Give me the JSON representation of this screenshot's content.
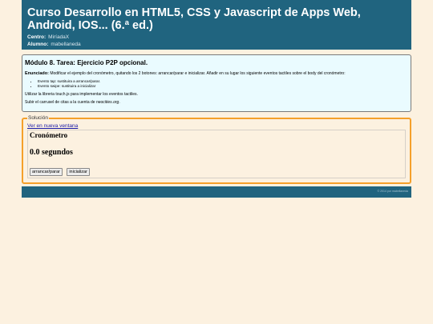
{
  "header": {
    "title": "Curso Desarrollo en HTML5, CSS y Javascript de Apps Web, Android, IOS... (6.ª ed.)",
    "center_label": "Centro:",
    "center_value": "MiríadaX",
    "student_label": "Alumno:",
    "student_value": "mabellaneda"
  },
  "task": {
    "title": "Módulo 8. Tarea: Ejercicio P2P opcional.",
    "statement_label": "Enunciado:",
    "statement_text": "Modificar el ejemplo del cronómetro, quitando los 2 botones: arrancar/parar e inicializar. Añadir en su lugar los siguiente eventos tactiles sobre el body del cronómetro:",
    "items": [
      "Evento tap: sustituira a arrancar/parar.",
      "Evento swipe: sustituira a inicializar"
    ],
    "note1": "Utilizar la libreria touch.js para implementar los eventos tactiles.",
    "note2_prefix": "Subir el carrusel de citas a la cuenta de ",
    "note2_site": "neocities.org",
    "note2_suffix": "."
  },
  "solution": {
    "legend": "Solución",
    "open_link": "Ver en nueva ventana",
    "heading": "Cronómetro",
    "time": "0.0 segundos",
    "start_stop_button": "arrancar/parar",
    "reset_button": "inicializar"
  },
  "footer": {
    "text": "© 2014 por mabellaneda"
  }
}
